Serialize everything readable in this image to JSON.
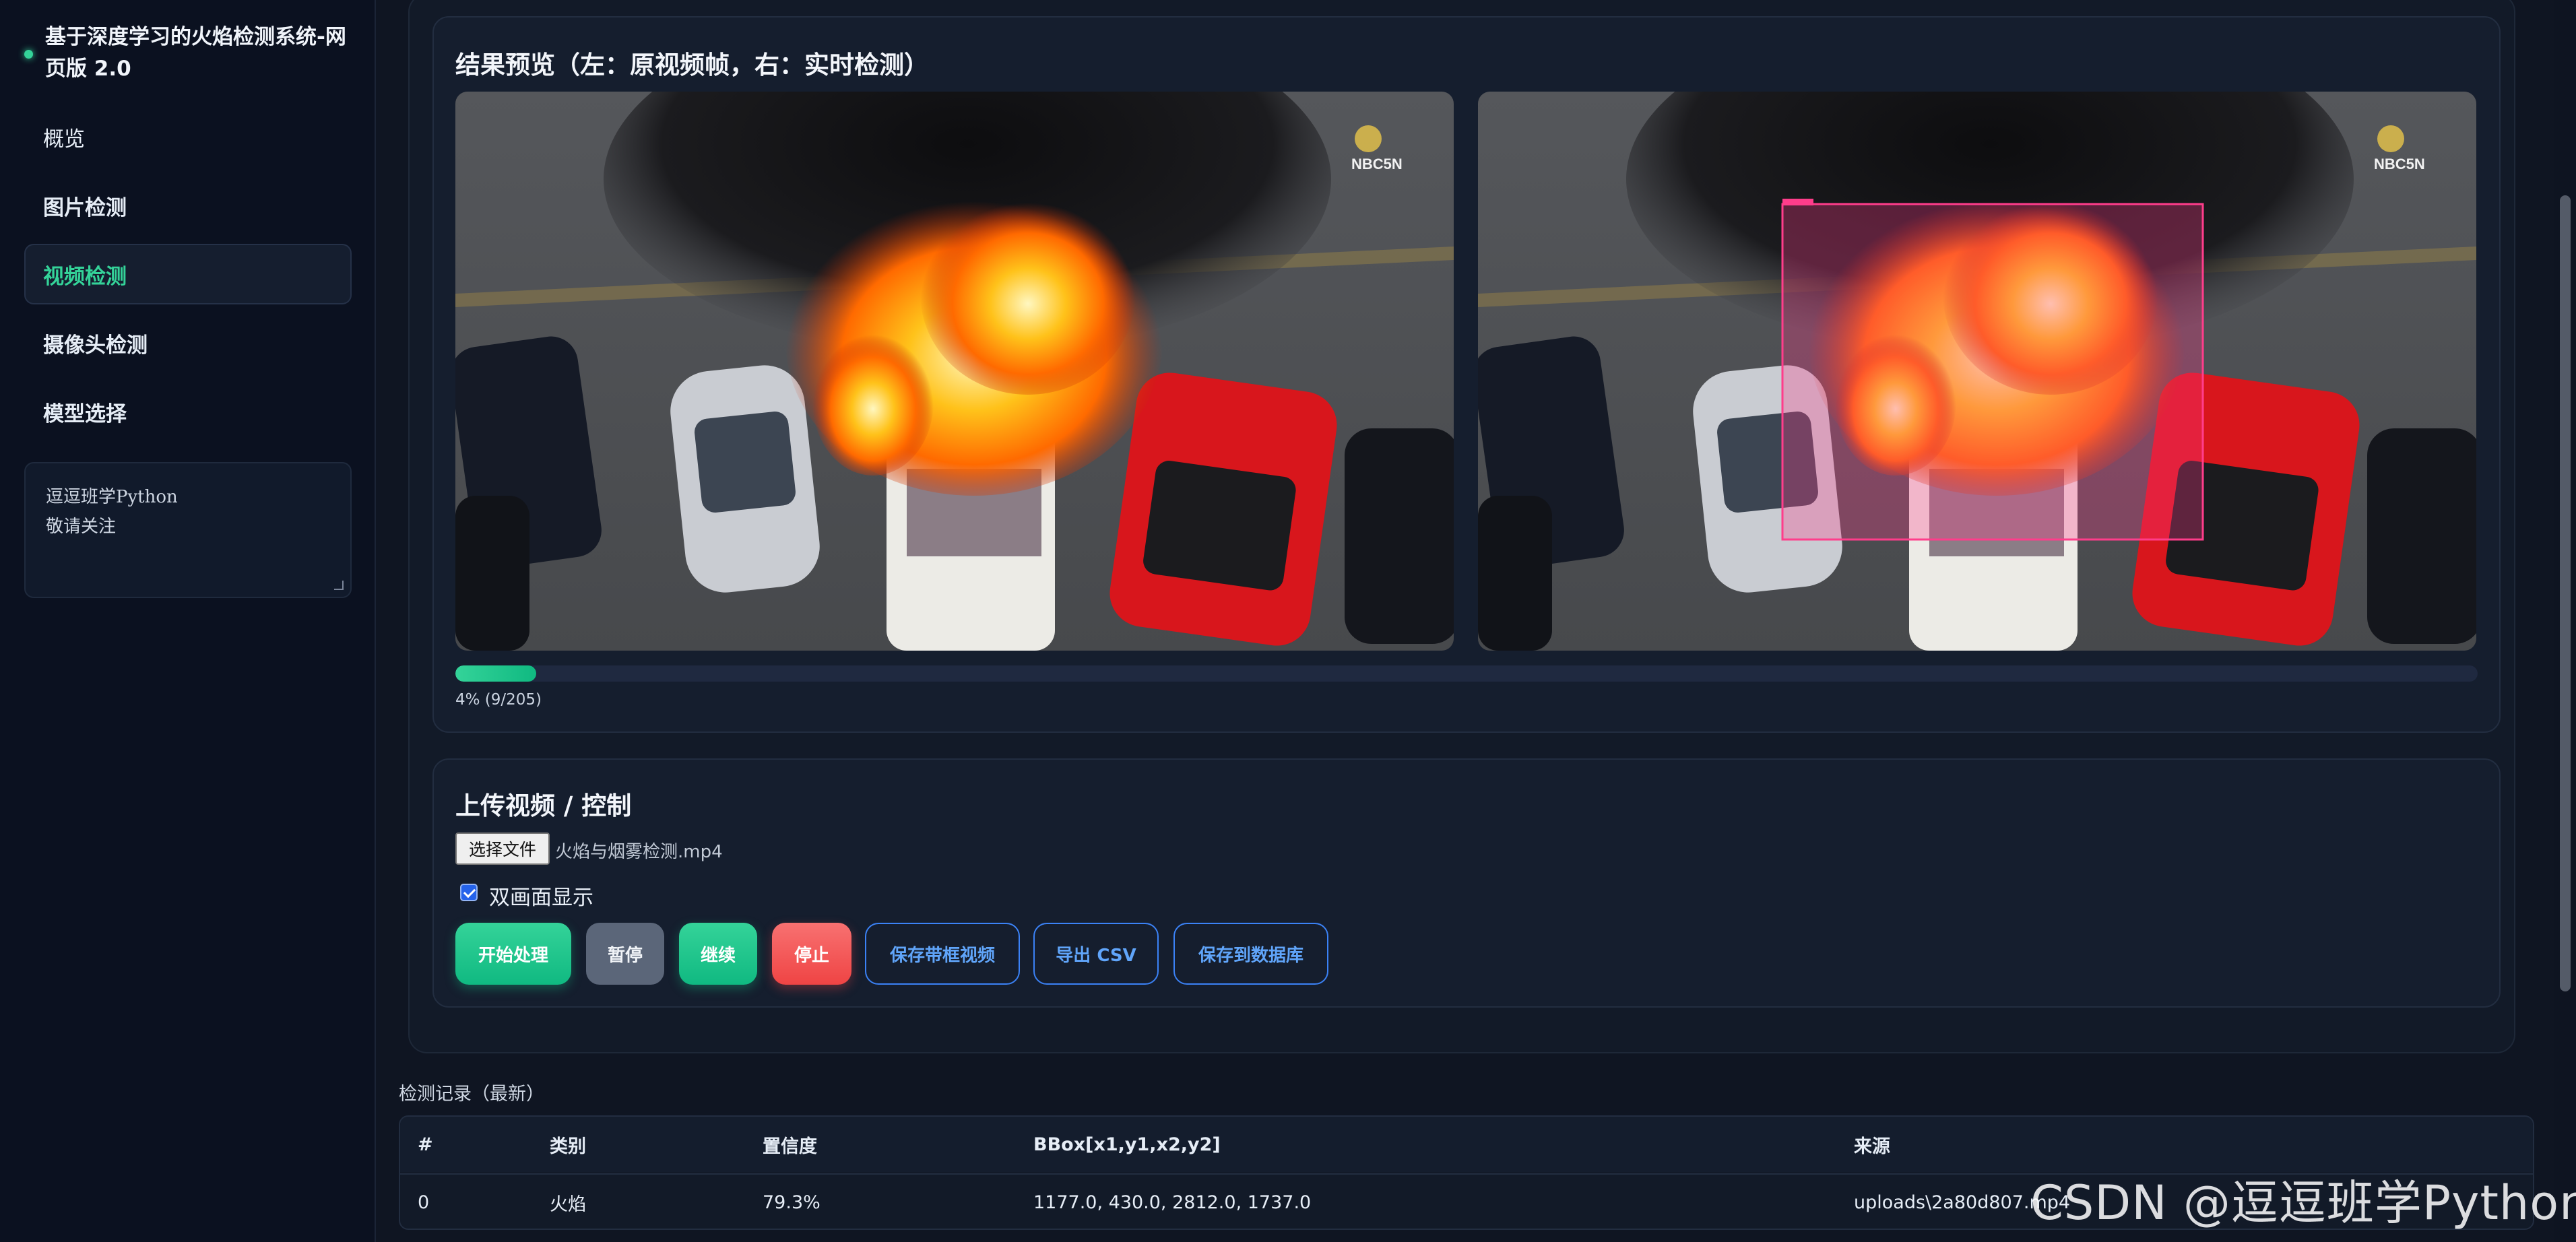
{
  "app": {
    "title": "基于深度学习的火焰检测系统-网页版 2.0"
  },
  "sidebar": {
    "items": [
      {
        "label": "概览"
      },
      {
        "label": "图片检测"
      },
      {
        "label": "视频检测"
      },
      {
        "label": "摄像头检测"
      },
      {
        "label": "模型选择"
      }
    ],
    "active_index": 2,
    "note_text": "逗逗班学Python\n敬请关注"
  },
  "preview": {
    "title": "结果预览（左：原视频帧，右：实时检测）",
    "logo_text": "NBC5N",
    "progress_fraction": 0.04,
    "progress_text": "4% (9/205)",
    "detection_box_color": "#ff3d8b"
  },
  "upload": {
    "title": "上传视频 / 控制",
    "file_button": "选择文件",
    "file_name": "火焰与烟雾检测.mp4",
    "dual_view_label": "双画面显示",
    "dual_view_checked": true,
    "buttons": {
      "start": "开始处理",
      "pause": "暂停",
      "resume": "继续",
      "stop": "停止",
      "save_video": "保存带框视频",
      "export_csv": "导出 CSV",
      "save_db": "保存到数据库"
    }
  },
  "records": {
    "title": "检测记录（最新）",
    "columns": [
      "#",
      "类别",
      "置信度",
      "BBox[x1,y1,x2,y2]",
      "来源"
    ],
    "rows": [
      [
        "0",
        "火焰",
        "79.3%",
        "1177.0, 430.0, 2812.0, 1737.0",
        "uploads\\2a80d807.mp4"
      ]
    ]
  },
  "watermark": "CSDN @逗逗班学Python",
  "colors": {
    "accent_green": "#34d399",
    "danger_red": "#ef4444",
    "link_blue": "#60a5fa",
    "background": "#0f1522"
  }
}
